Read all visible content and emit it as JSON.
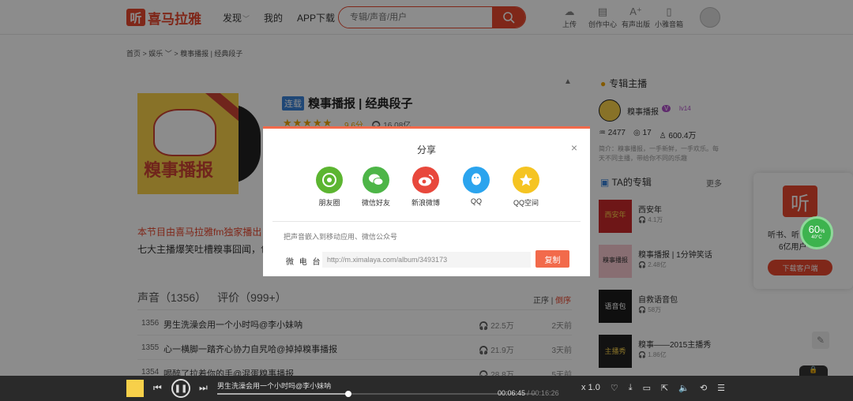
{
  "header": {
    "logo_mark": "听",
    "logo_text": "喜马拉雅",
    "nav": [
      {
        "label": "发现",
        "has_dropdown": true
      },
      {
        "label": "我的",
        "has_dropdown": false
      },
      {
        "label": "APP下载",
        "has_dropdown": false
      }
    ],
    "search_placeholder": "专辑/声音/用户",
    "tools": [
      {
        "icon": "upload-icon",
        "label": "上传"
      },
      {
        "icon": "creator-center-icon",
        "label": "创作中心"
      },
      {
        "icon": "audio-publish-icon",
        "label": "有声出版"
      },
      {
        "icon": "phone-icon",
        "label": "小雅音箱"
      }
    ]
  },
  "breadcrumb": {
    "home": "首页",
    "category": "娱乐",
    "current": "糗事播报 | 经典段子"
  },
  "album": {
    "tag": "连载",
    "title": "糗事播报 | 经典段子",
    "stars": "★★★★★",
    "score": "9.6分",
    "plays": "16.08亿",
    "cover_text": "糗事播报",
    "intro_highlight": "本节目由喜马拉雅fm独家播出",
    "intro_text": "七大主播爆笑吐槽糗事囧闻，包"
  },
  "tabs": {
    "sounds_label": "声音",
    "sounds_count": "（1356）",
    "reviews_label": "评价",
    "reviews_count": "（999+）",
    "sort_asc": "正序",
    "sort_sep": " | ",
    "sort_desc": "倒序"
  },
  "tracks": [
    {
      "num": "1356",
      "title": "男生洗澡会用一个小时吗@李小妹呐",
      "plays": "22.5万",
      "time": "2天前"
    },
    {
      "num": "1355",
      "title": "心一横脚一踏齐心协力自旯哈@掉掉糗事播报",
      "plays": "21.9万",
      "time": "3天前"
    },
    {
      "num": "1354",
      "title": "喝醉了拉着你的手@混蛋糗事播报",
      "plays": "28.8万",
      "time": "5天前"
    }
  ],
  "anchor": {
    "section_title": "专辑主播",
    "name": "糗事播报",
    "level": "lv14",
    "badge": "V",
    "following": "2477",
    "albums": "17",
    "fans": "600.4万",
    "intro": "简介：糗事播报，一手新鲜，一手欢乐。每天不同主播，带给你不同的乐趣"
  },
  "ta_albums": {
    "title": "TA的专辑",
    "more": "更多",
    "items": [
      {
        "name": "西安年",
        "plays": "4.1万",
        "color": "#c8282a",
        "thumb_text": "西安年"
      },
      {
        "name": "糗事播报 | 1分钟笑话",
        "plays": "2.48亿",
        "color": "#f7c8d0",
        "thumb_text": "糗事播报"
      },
      {
        "name": "自救语音包",
        "plays": "58万",
        "color": "#1c1c1c",
        "thumb_text": "语音包"
      },
      {
        "name": "糗事——2015主播秀",
        "plays": "1.86亿",
        "color": "#222222",
        "thumb_text": "主播秀"
      }
    ]
  },
  "download_card": {
    "logo": "听",
    "line1": "听书、听",
    "line2": "6亿用户",
    "button": "下载客户端"
  },
  "cpu_widget": {
    "percent": "60",
    "unit": "%",
    "temp": "40°C"
  },
  "share_modal": {
    "title": "分享",
    "close": "×",
    "targets": [
      {
        "label": "朋友圈",
        "icon": "moments-icon",
        "color": "#5cb531"
      },
      {
        "label": "微信好友",
        "icon": "wechat-icon",
        "color": "#4db547"
      },
      {
        "label": "新浪微博",
        "icon": "weibo-icon",
        "color": "#e8483c"
      },
      {
        "label": "QQ",
        "icon": "qq-icon",
        "color": "#2ba4ee"
      },
      {
        "label": "QQ空间",
        "icon": "qzone-icon",
        "color": "#f5c422"
      }
    ],
    "embed_hint": "把声音嵌入到移动应用、微信公众号",
    "embed_label": "微 电 台",
    "url": "http://m.ximalaya.com/album/3493173",
    "copy_button": "复制"
  },
  "player": {
    "title": "男生洗澡会用一个小时吗@李小妹呐",
    "current": "00:06:45",
    "total": " / 00:16:26",
    "progress": 0.41,
    "speed": "x 1.0"
  },
  "colors": {
    "brand": "#e8472f",
    "modal_accent": "#f26a4b"
  }
}
